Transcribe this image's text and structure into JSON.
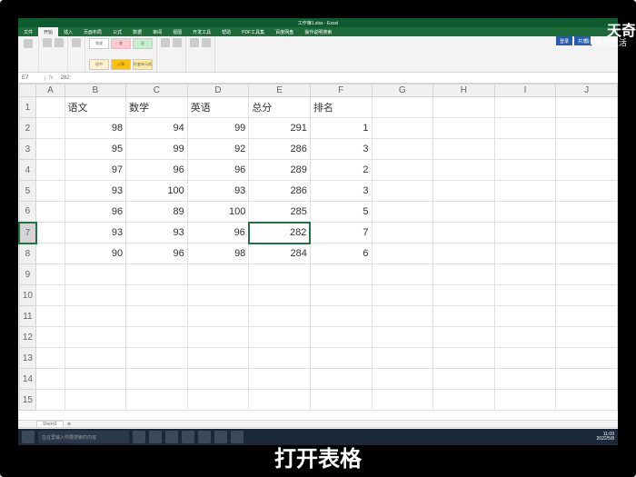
{
  "app": {
    "title": "工作簿1.xlsx - Excel"
  },
  "tabs": [
    "文件",
    "开始",
    "插入",
    "页面布局",
    "公式",
    "数据",
    "审阅",
    "视图",
    "开发工具",
    "帮助",
    "PDF工具集",
    "百度网盘"
  ],
  "tabs_action": "操作说明搜索",
  "account": {
    "login": "登录",
    "share": "共享"
  },
  "styles": {
    "normal": "常规",
    "bad": "差",
    "good": "好",
    "neutral": "适中",
    "calc": "计算",
    "check": "检查单元格"
  },
  "formula_bar": {
    "name": "E7",
    "value": "282"
  },
  "columns": [
    "",
    "A",
    "B",
    "C",
    "D",
    "E",
    "F",
    "G",
    "H",
    "I",
    "J"
  ],
  "headers": {
    "B": "语文",
    "C": "数学",
    "D": "英语",
    "E": "总分",
    "F": "排名"
  },
  "rows": [
    {
      "n": 2,
      "b": 98,
      "c": 94,
      "d": 99,
      "e": 291,
      "f": 1
    },
    {
      "n": 3,
      "b": 95,
      "c": 99,
      "d": 92,
      "e": 286,
      "f": 3
    },
    {
      "n": 4,
      "b": 97,
      "c": 96,
      "d": 96,
      "e": 289,
      "f": 2
    },
    {
      "n": 5,
      "b": 93,
      "c": 100,
      "d": 93,
      "e": 286,
      "f": 3
    },
    {
      "n": 6,
      "b": 96,
      "c": 89,
      "d": 100,
      "e": 285,
      "f": 5
    },
    {
      "n": 7,
      "b": 93,
      "c": 93,
      "d": 96,
      "e": 282,
      "f": 7
    },
    {
      "n": 8,
      "b": 90,
      "c": 96,
      "d": 98,
      "e": 284,
      "f": 6
    }
  ],
  "empty_rows": [
    9,
    10,
    11,
    12,
    13,
    14,
    15
  ],
  "sheet": {
    "name": "Sheet1"
  },
  "taskbar": {
    "search": "在这里输入你要搜索的内容",
    "time": "11:09",
    "date": "2022/5/8"
  },
  "watermark": {
    "main": "天奇",
    "sub": "天奇生活"
  },
  "caption": "打开表格"
}
